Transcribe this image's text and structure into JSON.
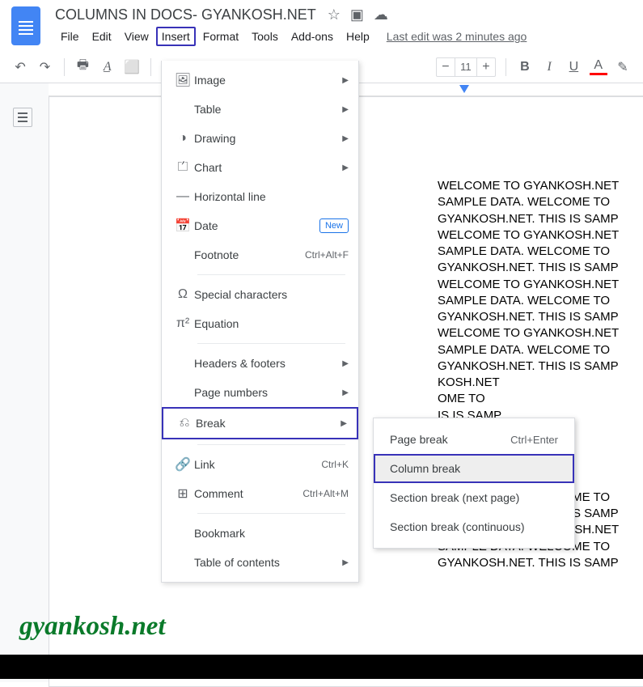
{
  "doc": {
    "title": "COLUMNS IN DOCS- GYANKOSH.NET"
  },
  "menus": {
    "file": "File",
    "edit": "Edit",
    "view": "View",
    "insert": "Insert",
    "format": "Format",
    "tools": "Tools",
    "addons": "Add-ons",
    "help": "Help"
  },
  "last_edit": "Last edit was 2 minutes ago",
  "toolbar": {
    "font_size": "11"
  },
  "insert_menu": {
    "image": "Image",
    "table": "Table",
    "drawing": "Drawing",
    "chart": "Chart",
    "hline": "Horizontal line",
    "date": "Date",
    "date_badge": "New",
    "footnote": "Footnote",
    "footnote_sc": "Ctrl+Alt+F",
    "special": "Special characters",
    "equation": "Equation",
    "headers": "Headers & footers",
    "pagenums": "Page numbers",
    "break": "Break",
    "link": "Link",
    "link_sc": "Ctrl+K",
    "comment": "Comment",
    "comment_sc": "Ctrl+Alt+M",
    "bookmark": "Bookmark",
    "toc": "Table of contents"
  },
  "break_submenu": {
    "page": "Page break",
    "page_sc": "Ctrl+Enter",
    "column": "Column break",
    "section_next": "Section break (next page)",
    "section_cont": "Section break (continuous)"
  },
  "body_text": "WELCOME TO GYANKOSH.NET\nSAMPLE DATA. WELCOME TO\nGYANKOSH.NET. THIS IS SAMP\nWELCOME TO GYANKOSH.NET\nSAMPLE DATA. WELCOME TO\nGYANKOSH.NET. THIS IS SAMP\nWELCOME TO GYANKOSH.NET\nSAMPLE DATA. WELCOME TO\nGYANKOSH.NET. THIS IS SAMP\nWELCOME TO GYANKOSH.NET\nSAMPLE DATA. WELCOME TO\nGYANKOSH.NET. THIS IS SAMP\n                               KOSH.NET\n                               OME TO\n                               IS IS SAMP\n                               KOSH.NET\n                               OME TO\n                               IS IS SAMP\n                               KOSH.NET\nSAMPLE DATA. WELCOME TO\nGYANKOSH.NET. THIS IS SAMP\nWELCOME TO GYANKOSH.NET\nSAMPLE DATA. WELCOME TO\nGYANKOSH.NET. THIS IS SAMP",
  "watermark": "gyankosh.net"
}
